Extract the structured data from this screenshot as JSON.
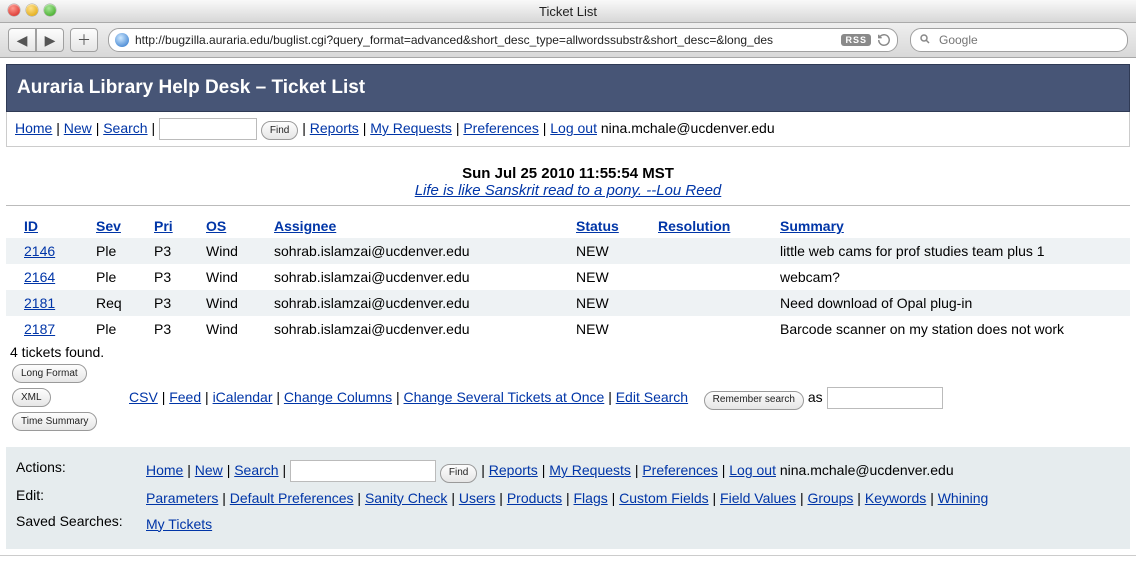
{
  "browser": {
    "window_title": "Ticket List",
    "url": "http://bugzilla.auraria.edu/buglist.cgi?query_format=advanced&short_desc_type=allwordssubstr&short_desc=&long_des",
    "rss_label": "RSS",
    "search_placeholder": "Google"
  },
  "banner_title": "Auraria Library Help Desk – Ticket List",
  "nav": {
    "home": "Home",
    "new": "New",
    "search": "Search",
    "find": "Find",
    "reports": "Reports",
    "my_requests": "My Requests",
    "preferences": "Preferences",
    "logout": "Log out",
    "user_email": "nina.mchale@ucdenver.edu"
  },
  "timestamp": "Sun Jul 25 2010 11:55:54 MST",
  "quote": "Life is like Sanskrit read to a pony. --Lou Reed",
  "columns": {
    "id": "ID",
    "sev": "Sev",
    "pri": "Pri",
    "os": "OS",
    "assignee": "Assignee",
    "status": "Status",
    "resolution": "Resolution",
    "summary": "Summary"
  },
  "rows": [
    {
      "id": "2146",
      "sev": "Ple",
      "pri": "P3",
      "os": "Wind",
      "assignee": "sohrab.islamzai@ucdenver.edu",
      "status": "NEW",
      "resolution": "",
      "summary": "little web cams for prof studies team plus 1"
    },
    {
      "id": "2164",
      "sev": "Ple",
      "pri": "P3",
      "os": "Wind",
      "assignee": "sohrab.islamzai@ucdenver.edu",
      "status": "NEW",
      "resolution": "",
      "summary": "webcam?"
    },
    {
      "id": "2181",
      "sev": "Req",
      "pri": "P3",
      "os": "Wind",
      "assignee": "sohrab.islamzai@ucdenver.edu",
      "status": "NEW",
      "resolution": "",
      "summary": "Need download of Opal plug-in"
    },
    {
      "id": "2187",
      "sev": "Ple",
      "pri": "P3",
      "os": "Wind",
      "assignee": "sohrab.islamzai@ucdenver.edu",
      "status": "NEW",
      "resolution": "",
      "summary": "Barcode scanner on my station does not work"
    }
  ],
  "found_text": "4 tickets found.",
  "buttons": {
    "long_format": "Long Format",
    "xml": "XML",
    "time_summary": "Time Summary",
    "remember_search": "Remember search"
  },
  "export_links": {
    "csv": "CSV",
    "feed": "Feed",
    "icalendar": "iCalendar",
    "change_columns": "Change Columns",
    "change_several": "Change Several Tickets at Once",
    "edit_search": "Edit Search",
    "as_label": "as"
  },
  "footer": {
    "labels": {
      "actions": "Actions:",
      "edit": "Edit:",
      "saved": "Saved Searches:"
    },
    "edit_links": {
      "parameters": "Parameters",
      "default_preferences": "Default Preferences",
      "sanity_check": "Sanity Check",
      "users": "Users",
      "products": "Products",
      "flags": "Flags",
      "custom_fields": "Custom Fields",
      "field_values": "Field Values",
      "groups": "Groups",
      "keywords": "Keywords",
      "whining": "Whining"
    },
    "saved": {
      "my_tickets": "My Tickets"
    }
  }
}
